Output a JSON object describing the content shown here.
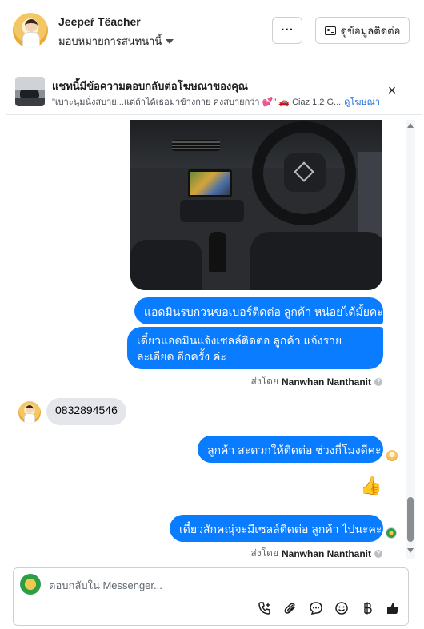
{
  "header": {
    "page_name": "Jeepeŕ Tëacher",
    "assign_label": "มอบหมายการสนทนานี้",
    "more_label": "···",
    "contact_button_label": "ดูข้อมูลติดต่อ"
  },
  "ad_banner": {
    "title": "แชทนี้มีข้อความตอบกลับต่อโฆษณาของคุณ",
    "description": "\"เบาะนุ่มนั่งสบาย...แต่ถ้าได้เธอมาข้างกาย คงสบายกว่า 💕\" 🚗 Ciaz 1.2 G...",
    "view_ad_link": "ดูโฆษณา",
    "close_label": "×"
  },
  "messages": [
    {
      "direction": "out",
      "text": "แอดมินรบกวนขอเบอร์ติดต่อ ลูกค้า หน่อยได้มั้ยคะ"
    },
    {
      "direction": "out",
      "text": "เดี๋ยวแอดมินแจ้งเซลล์ติดต่อ ลูกค้า แจ้งรายละเอียด อีกครั้ง ค่ะ"
    },
    {
      "direction": "in",
      "text": "0832894546"
    },
    {
      "direction": "out",
      "text": "ลูกค้า สะดวกให้ติดต่อ ช่วงกี่โมงดีคะ"
    },
    {
      "direction": "out",
      "text": "เดี๋ยวสักคณุ่จะมีเซลล์ติดต่อ ลูกค้า ไปนะคะ"
    }
  ],
  "sent_by": {
    "prefix": "ส่งโดย",
    "name": "Nanwhan Nanthanit",
    "info_icon_text": "?"
  },
  "like_glyph": "👍",
  "composer": {
    "placeholder": "ตอบกลับใน Messenger..."
  },
  "icons": {
    "more": "more-icon",
    "contact": "contact-card-icon",
    "close": "close-icon",
    "call": "add-call-icon",
    "attach": "attach-icon",
    "saved_reply": "saved-reply-icon",
    "emoji": "emoji-icon",
    "payment": "baht-icon",
    "like": "like-icon"
  },
  "colors": {
    "outgoing_bubble": "#0a7cff",
    "incoming_bubble": "#e4e6eb",
    "link": "#216fdb"
  }
}
